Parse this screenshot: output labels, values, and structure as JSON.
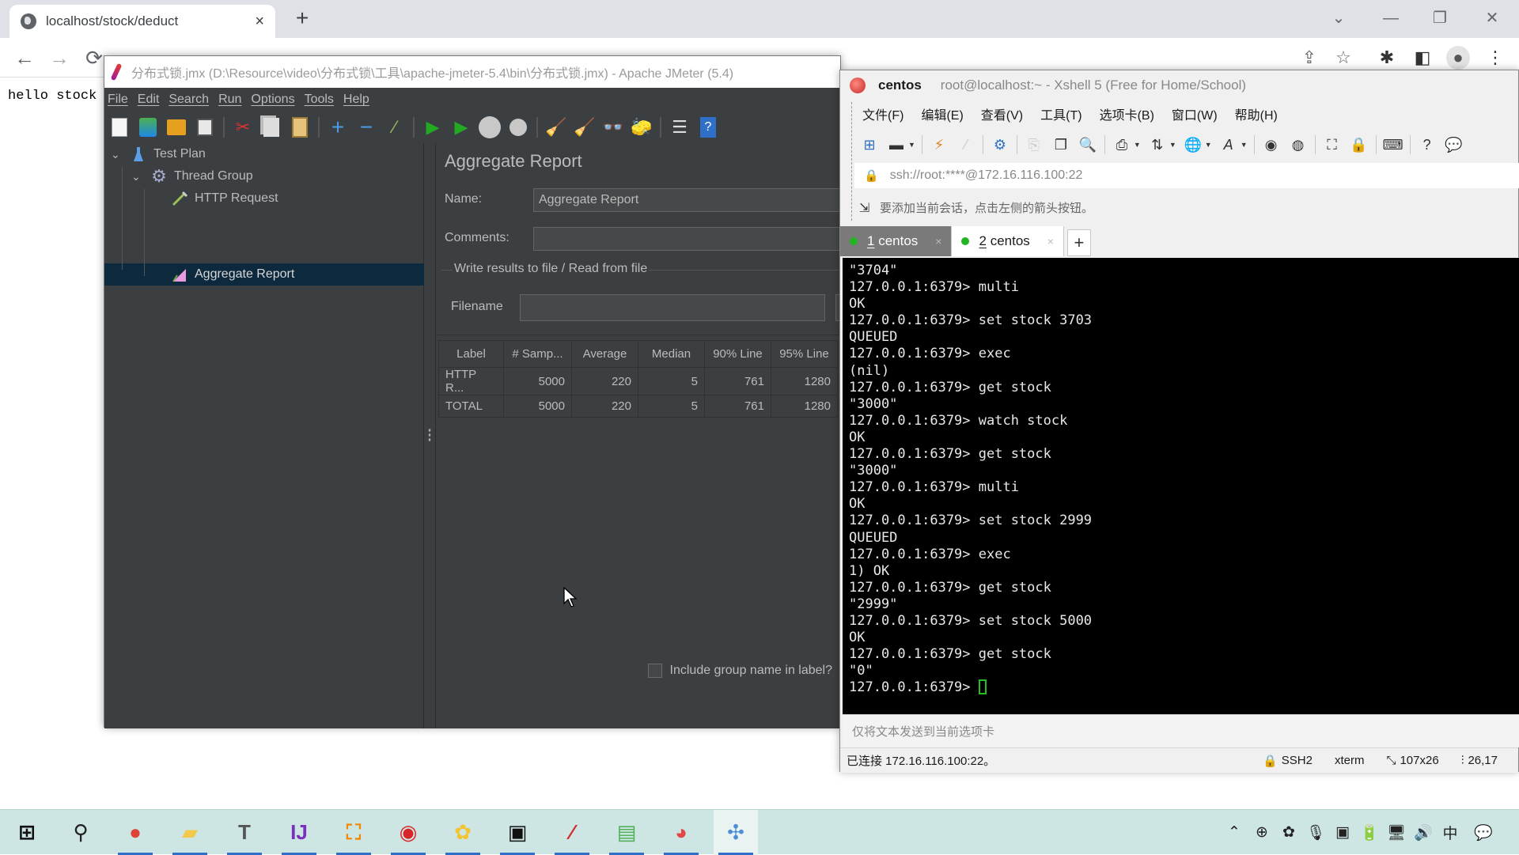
{
  "browser": {
    "tab_title": "localhost/stock/deduct",
    "tab_close": "×",
    "new_tab": "+",
    "page_text": "hello stock",
    "controls": {
      "tabs_dropdown": "⌄",
      "minimize": "—",
      "restore": "❐",
      "close": "✕"
    },
    "nav": {
      "back": "←",
      "forward": "→",
      "reload": "⟳"
    },
    "toolbar_icons": {
      "share": "⇪",
      "bookmark": "☆",
      "extensions": "✱",
      "side_panel": "◧",
      "profile": "●",
      "menu": "⋮"
    }
  },
  "jmeter": {
    "title": "分布式锁.jmx (D:\\Resource\\video\\分布式锁\\工具\\apache-jmeter-5.4\\bin\\分布式锁.jmx) - Apache JMeter (5.4)",
    "menu": [
      "File",
      "Edit",
      "Search",
      "Run",
      "Options",
      "Tools",
      "Help"
    ],
    "tree": [
      {
        "label": "Test Plan",
        "level": 0,
        "expanded": true,
        "icon": "flask-icon"
      },
      {
        "label": "Thread Group",
        "level": 1,
        "expanded": true,
        "icon": "gear-icon"
      },
      {
        "label": "HTTP Request",
        "level": 2,
        "icon": "pipette-icon"
      },
      {
        "label": "Aggregate Report",
        "level": 2,
        "icon": "chart-icon",
        "selected": true
      }
    ],
    "panel": {
      "title": "Aggregate Report",
      "name_label": "Name:",
      "name_value": "Aggregate Report",
      "comments_label": "Comments:",
      "comments_value": "",
      "file_group_label": "Write results to file / Read from file",
      "filename_label": "Filename",
      "filename_value": "",
      "include_group_label": "Include group name in label?",
      "include_group_checked": false
    },
    "table": {
      "columns": [
        "Label",
        "# Samp...",
        "Average",
        "Median",
        "90% Line",
        "95% Line"
      ],
      "rows": [
        [
          "HTTP R...",
          "5000",
          "220",
          "5",
          "761",
          "1280"
        ],
        [
          "TOTAL",
          "5000",
          "220",
          "5",
          "761",
          "1280"
        ]
      ]
    }
  },
  "xshell": {
    "session_name": "centos",
    "title": "root@localhost:~ - Xshell 5 (Free for Home/School)",
    "menu": [
      "文件(F)",
      "编辑(E)",
      "查看(V)",
      "工具(T)",
      "选项卡(B)",
      "窗口(W)",
      "帮助(H)"
    ],
    "address": "ssh://root:****@172.16.116.100:22",
    "hint": "要添加当前会话，点击左侧的箭头按钮。",
    "tabs": [
      {
        "num": "1",
        "label": "centos",
        "active": true
      },
      {
        "num": "2",
        "label": "centos",
        "active": false
      }
    ],
    "tab_add": "+",
    "terminal_lines": [
      "\"3704\"",
      "127.0.0.1:6379> multi",
      "OK",
      "127.0.0.1:6379> set stock 3703",
      "QUEUED",
      "127.0.0.1:6379> exec",
      "(nil)",
      "127.0.0.1:6379> get stock",
      "\"3000\"",
      "127.0.0.1:6379> watch stock",
      "OK",
      "127.0.0.1:6379> get stock",
      "\"3000\"",
      "127.0.0.1:6379> multi",
      "OK",
      "127.0.0.1:6379> set stock 2999",
      "QUEUED",
      "127.0.0.1:6379> exec",
      "1) OK",
      "127.0.0.1:6379> get stock",
      "\"2999\"",
      "127.0.0.1:6379> set stock 5000",
      "OK",
      "127.0.0.1:6379> get stock",
      "\"0\""
    ],
    "prompt": "127.0.0.1:6379> ",
    "send_placeholder": "仅将文本发送到当前选项卡",
    "status": {
      "connection": "已连接 172.16.116.100:22。",
      "protocol": "SSH2",
      "terminal_type": "xterm",
      "size": "107x26",
      "cursor_pos": "26,17"
    }
  },
  "taskbar": {
    "apps": [
      {
        "name": "start",
        "glyph": "⊞",
        "color": "#111111"
      },
      {
        "name": "search",
        "glyph": "⚲",
        "color": "#222222"
      },
      {
        "name": "chrome",
        "glyph": "●",
        "color": "#db4437"
      },
      {
        "name": "file-explorer",
        "glyph": "▰",
        "color": "#f2c94c"
      },
      {
        "name": "typora",
        "glyph": "T",
        "color": "#555555"
      },
      {
        "name": "intellij-idea",
        "glyph": "IJ",
        "color": "#7b2fbf"
      },
      {
        "name": "draw-io",
        "glyph": "⛶",
        "color": "#f08705"
      },
      {
        "name": "app-red",
        "glyph": "◉",
        "color": "#d7262a"
      },
      {
        "name": "app-yellow",
        "glyph": "✿",
        "color": "#f4c430"
      },
      {
        "name": "terminal",
        "glyph": "▣",
        "color": "#111111"
      },
      {
        "name": "jmeter",
        "glyph": "⁄",
        "color": "#d42a2a"
      },
      {
        "name": "notepad",
        "glyph": "▤",
        "color": "#4caf50"
      },
      {
        "name": "xshell",
        "glyph": "◕",
        "color": "#e04848"
      },
      {
        "name": "network-app",
        "glyph": "✣",
        "color": "#4a8fd8"
      }
    ],
    "tray": [
      "⌃",
      "⊕",
      "✿",
      "🎙",
      "▣",
      "🔋",
      "🖥",
      "🔊",
      "中",
      "💬"
    ]
  }
}
